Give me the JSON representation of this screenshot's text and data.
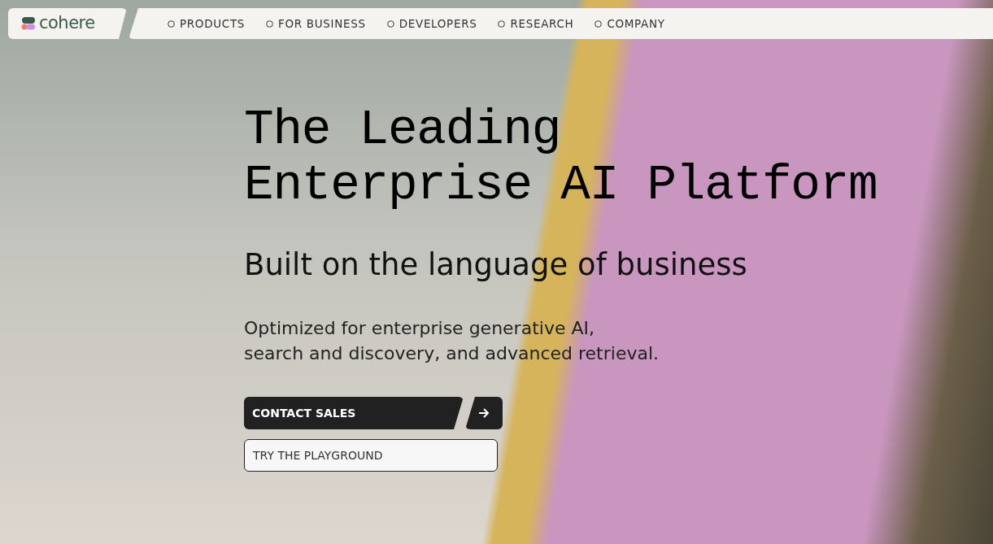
{
  "logo": {
    "text": "cohere"
  },
  "nav": [
    {
      "label": "PRODUCTS"
    },
    {
      "label": "FOR BUSINESS"
    },
    {
      "label": "DEVELOPERS"
    },
    {
      "label": "RESEARCH"
    },
    {
      "label": "COMPANY"
    }
  ],
  "hero": {
    "headline": [
      "The Leading",
      "Enterprise AI Platform"
    ],
    "subheadline": "Built on the language of business",
    "description": [
      "Optimized for enterprise generative AI,",
      "search and discovery, and advanced retrieval."
    ]
  },
  "buttons": [
    {
      "kind": "primary",
      "label": "CONTACT SALES"
    },
    {
      "kind": "secondary",
      "label": "TRY THE PLAYGROUND"
    }
  ]
}
